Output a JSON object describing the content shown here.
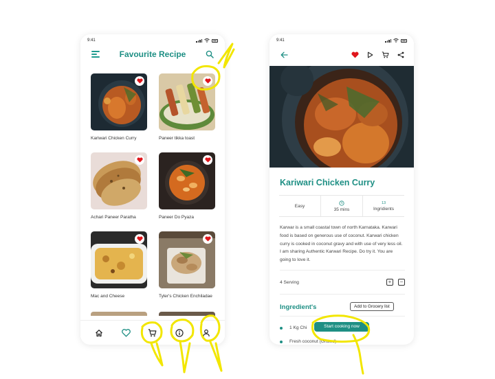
{
  "left_screen": {
    "status_time": "9:41",
    "title": "Favourite Recipe",
    "icons": {
      "menu": "menu-icon",
      "search": "search-icon"
    },
    "recipes": [
      {
        "name": "Kariwari Chicken Curry",
        "favourite": true
      },
      {
        "name": "Paneer tikka toast",
        "favourite": true
      },
      {
        "name": "Achari Paneer Paratha",
        "favourite": true
      },
      {
        "name": "Paneer Do Pyaza",
        "favourite": true
      },
      {
        "name": "Mac and Cheese",
        "favourite": true
      },
      {
        "name": "Tyler's Chicken Enchiladae",
        "favourite": true
      }
    ],
    "bottom_nav": [
      "home-icon",
      "heart-icon",
      "cart-icon",
      "info-icon",
      "user-icon"
    ],
    "active_nav": "heart-icon"
  },
  "right_screen": {
    "status_time": "9:41",
    "title": "Kariwari Chicken Curry",
    "meta": {
      "difficulty": "Easy",
      "time": "35 mins",
      "ingredients_count": "13",
      "ingredients_label": "Ingridients"
    },
    "description": "Karwar is a small coastal town of north Karnataka. Karwari food is based on generous use of coconut. Karwari chicken curry is cooked in coconut gravy and with use of very less oil. I am sharing Authentic Karwari Recipe. Do try it. You are going to love it.",
    "serving": "4 Serving",
    "ingredients_heading": "Ingredient's",
    "grocery_button": "Add to Grocery list",
    "ingredients": [
      "1 Kg Chi",
      "Fresh coconut (Grated)"
    ],
    "cook_button": "Start cooking now"
  },
  "colors": {
    "accent": "#1e8f84",
    "favourite": "#e0161c",
    "annotation": "#f2e600"
  }
}
